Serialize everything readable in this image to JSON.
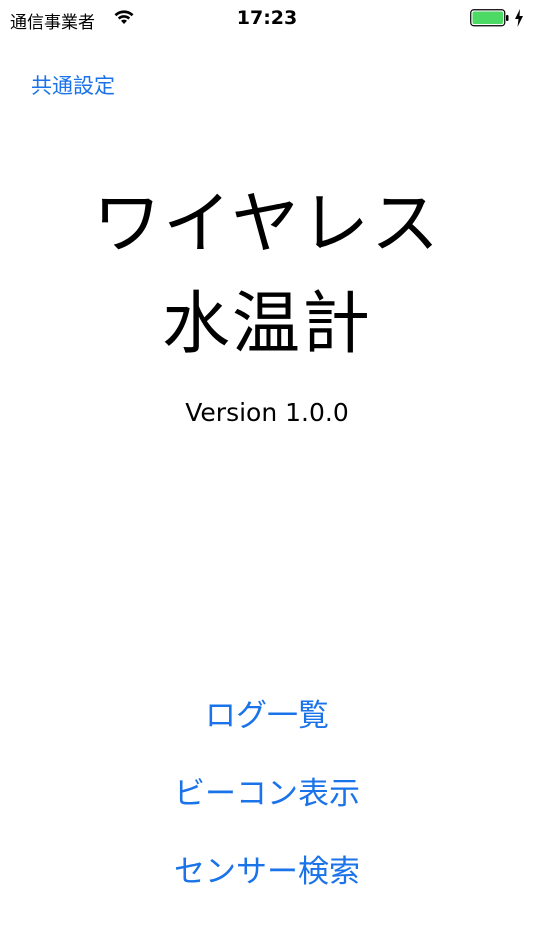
{
  "status_bar": {
    "carrier": "通信事業者",
    "time": "17:23",
    "wifi_icon": "wifi-icon",
    "battery_icon": "battery-icon",
    "charging_icon": "charging-bolt-icon",
    "battery_color": "#4cd964"
  },
  "nav": {
    "settings_label": "共通設定"
  },
  "app": {
    "title_line1": "ワイヤレス",
    "title_line2": "水温計",
    "version": "Version 1.0.0"
  },
  "menu": {
    "log_label": "ログ一覧",
    "beacon_label": "ビーコン表示",
    "sensor_label": "センサー検索"
  },
  "colors": {
    "accent": "#1a73e8",
    "text": "#000000",
    "background": "#ffffff"
  }
}
